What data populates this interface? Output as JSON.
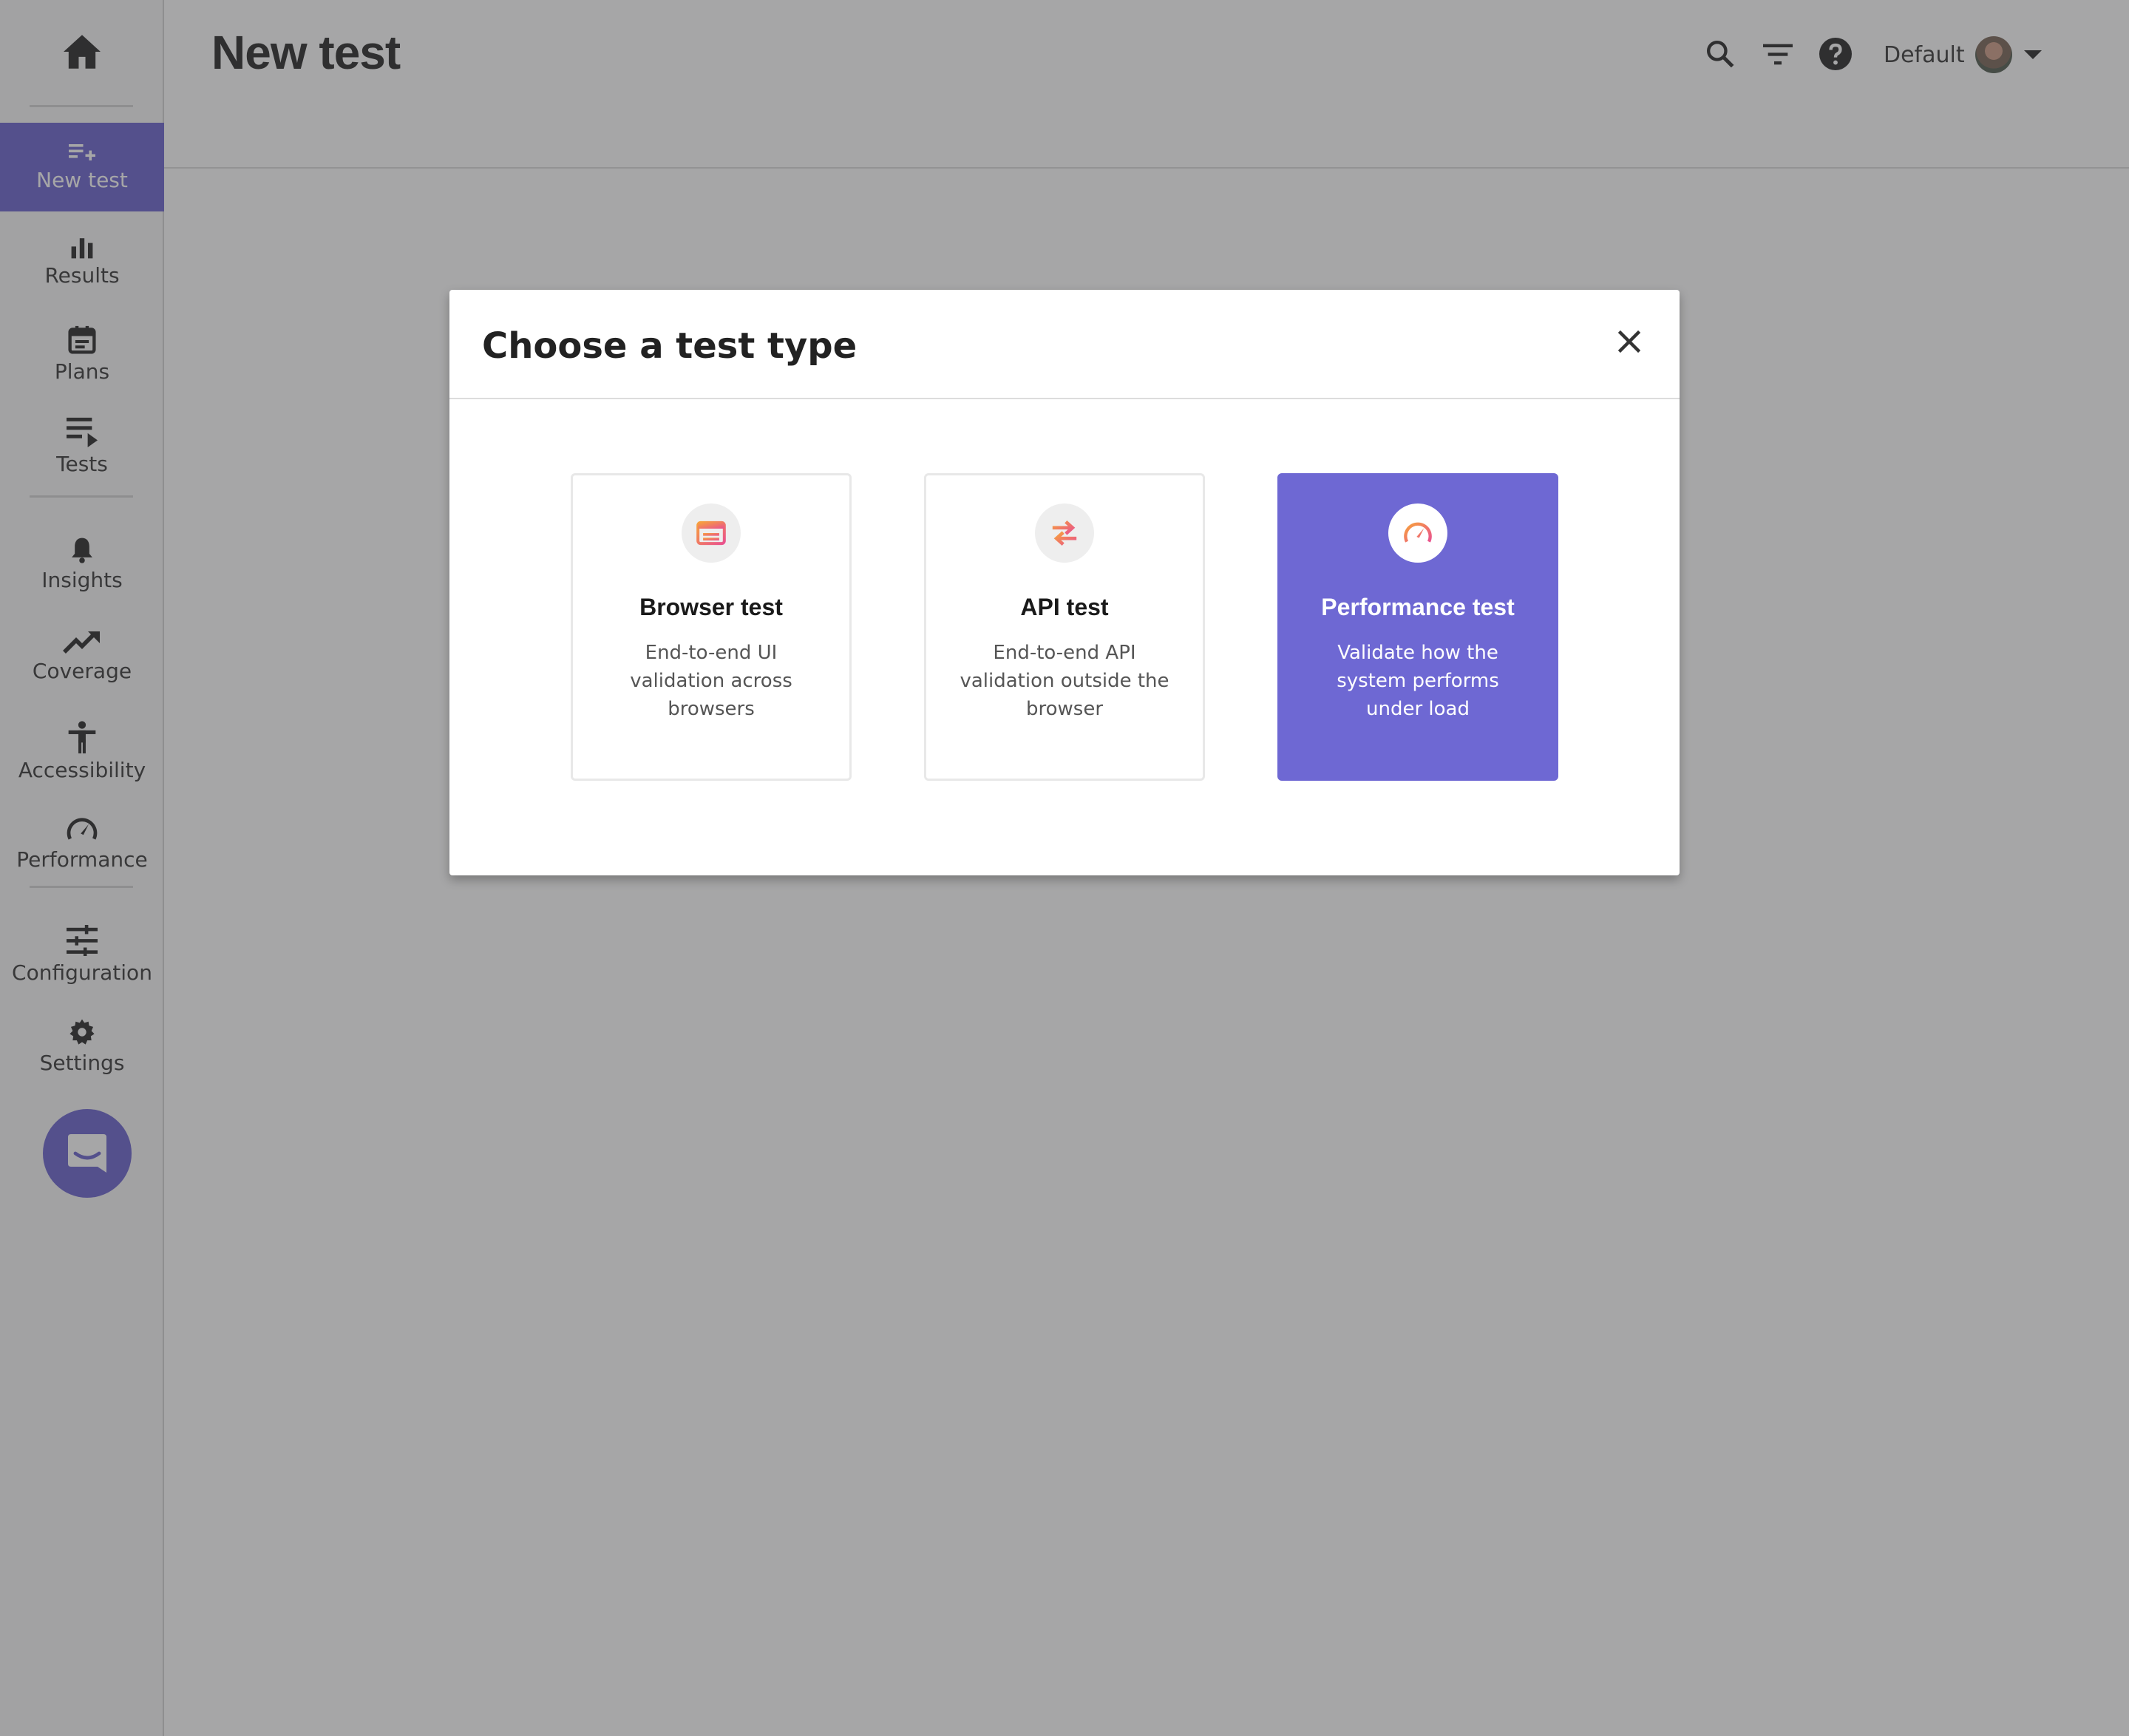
{
  "sidebar": {
    "home_icon": "home-icon",
    "items": [
      {
        "label": "New test",
        "icon": "playlist-add-icon",
        "active": true
      },
      {
        "label": "Results",
        "icon": "bar-chart-icon"
      },
      {
        "label": "Plans",
        "icon": "calendar-icon"
      },
      {
        "label": "Tests",
        "icon": "playlist-play-icon"
      },
      {
        "label": "Insights",
        "icon": "bell-icon"
      },
      {
        "label": "Coverage",
        "icon": "trending-up-icon"
      },
      {
        "label": "Accessibility",
        "icon": "accessibility-icon"
      },
      {
        "label": "Performance",
        "icon": "speedometer-icon"
      },
      {
        "label": "Configuration",
        "icon": "tune-icon"
      },
      {
        "label": "Settings",
        "icon": "gear-icon"
      }
    ],
    "chat_icon": "chat-icon"
  },
  "header": {
    "title": "New test",
    "workspace": "Default",
    "icons": [
      "search-icon",
      "filter-icon",
      "help-icon",
      "avatar",
      "caret-down-icon"
    ]
  },
  "modal": {
    "title": "Choose a test type",
    "options": [
      {
        "title": "Browser test",
        "description": "End-to-end UI validation across browsers",
        "icon": "browser-window-icon",
        "selected": false
      },
      {
        "title": "API test",
        "description": "End-to-end API validation outside the browser",
        "icon": "swap-arrows-icon",
        "selected": false
      },
      {
        "title": "Performance test",
        "description": "Validate how the system performs under load",
        "icon": "speedometer-icon",
        "selected": true
      }
    ]
  },
  "colors": {
    "accent": "#5b52c9",
    "selected_card": "#6e68d3",
    "overlay": "#4d4d50"
  }
}
